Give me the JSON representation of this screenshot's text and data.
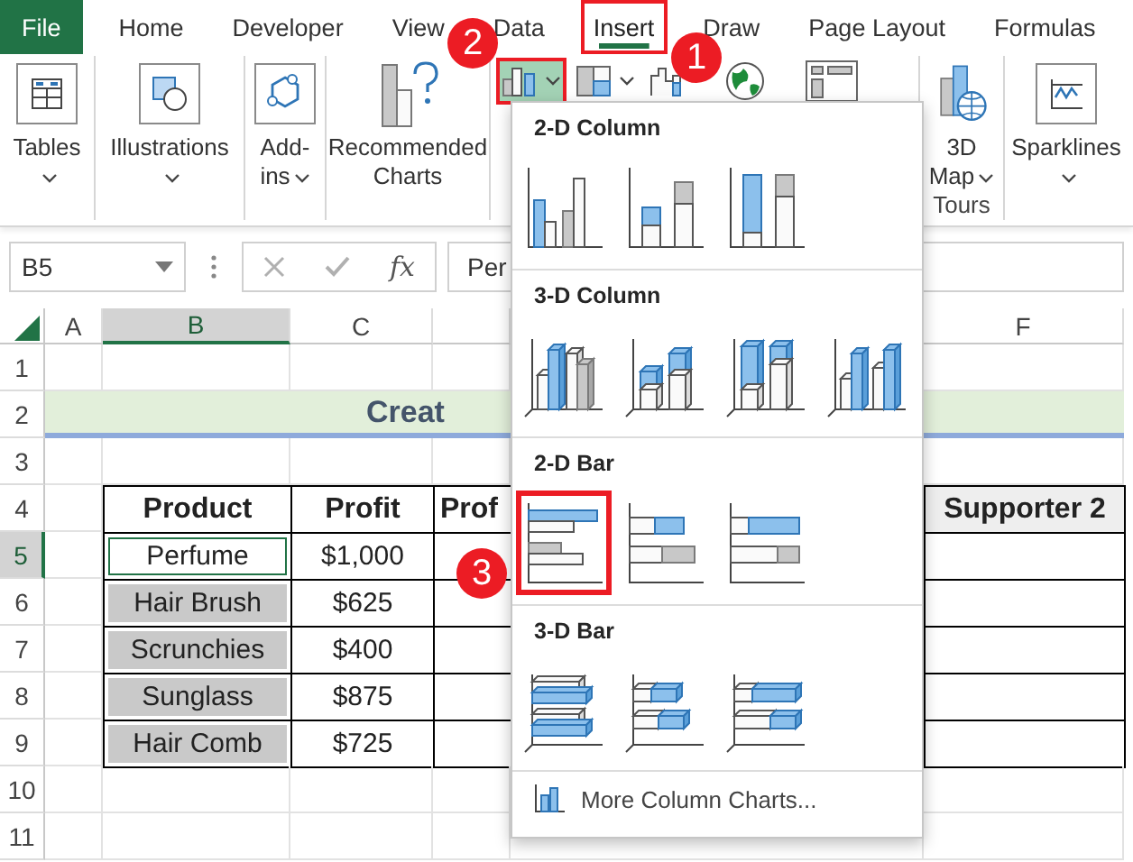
{
  "tabs": [
    {
      "label": "File",
      "kind": "file",
      "selected": false
    },
    {
      "label": "Home",
      "kind": "tab",
      "selected": false
    },
    {
      "label": "Developer",
      "kind": "tab",
      "selected": false
    },
    {
      "label": "View",
      "kind": "tab",
      "selected": false
    },
    {
      "label": "Data",
      "kind": "tab",
      "selected": false
    },
    {
      "label": "Insert",
      "kind": "tab",
      "selected": true,
      "callout": "1"
    },
    {
      "label": "Draw",
      "kind": "tab",
      "selected": false
    },
    {
      "label": "Page Layout",
      "kind": "tab",
      "selected": false
    },
    {
      "label": "Formulas",
      "kind": "tab",
      "selected": false
    }
  ],
  "ribbon_left": [
    {
      "label": "Tables",
      "dropdown": true
    },
    {
      "label": "Illustrations",
      "dropdown": true
    },
    {
      "label": "Add-ins",
      "dropdown": true
    },
    {
      "label": "Recommended Charts",
      "dropdown": false
    }
  ],
  "chart_buttons": [
    {
      "dropdown": true,
      "pressed": true,
      "callout": "2"
    },
    {
      "dropdown": true,
      "pressed": false
    },
    {
      "dropdown": false,
      "pressed": false
    },
    {
      "dropdown": false,
      "pressed": false
    },
    {
      "dropdown": false,
      "pressed": false
    }
  ],
  "ribbon_right": [
    {
      "label": "3D Map",
      "dropdown": true,
      "group_label": "Tours"
    },
    {
      "label": "Sparklines",
      "dropdown": true
    }
  ],
  "formula_bar": {
    "name_box": "B5",
    "function_label": "fx",
    "formula": "Per"
  },
  "sheet": {
    "columns": [
      {
        "label": "A",
        "selected": false
      },
      {
        "label": "B",
        "selected": true
      },
      {
        "label": "C",
        "selected": false
      },
      {
        "selected": false
      },
      {
        "label": "F",
        "selected": false
      }
    ],
    "rows": [
      {
        "number": "1",
        "selected": false
      },
      {
        "number": "2",
        "selected": false
      },
      {
        "number": "3",
        "selected": false
      },
      {
        "number": "4",
        "selected": false
      },
      {
        "number": "5",
        "selected": true
      },
      {
        "number": "6",
        "selected": false
      },
      {
        "number": "7",
        "selected": false
      },
      {
        "number": "8",
        "selected": false
      },
      {
        "number": "9",
        "selected": false
      },
      {
        "number": "10",
        "selected": false
      },
      {
        "number": "11",
        "selected": false
      }
    ],
    "title": "Creat",
    "table": {
      "header": [
        "Product",
        "Profit",
        "Prof",
        "Supporter 2"
      ],
      "rows": [
        {
          "product": "Perfume",
          "profit": "$1,000",
          "selected": true
        },
        {
          "product": "Hair Brush",
          "profit": "$625",
          "selected": false
        },
        {
          "product": "Scrunchies",
          "profit": "$400",
          "selected": false
        },
        {
          "product": "Sunglass",
          "profit": "$875",
          "selected": false
        },
        {
          "product": "Hair Comb",
          "profit": "$725",
          "selected": false
        }
      ]
    }
  },
  "chart_menu": {
    "sections": [
      {
        "title": "2-D Column",
        "kind": "column",
        "items": [
          {
            "kind": "clustered"
          },
          {
            "kind": "stacked"
          },
          {
            "kind": "percent"
          }
        ]
      },
      {
        "title": "3-D Column",
        "kind": "column3d",
        "items": [
          {
            "kind": "clustered"
          },
          {
            "kind": "stacked"
          },
          {
            "kind": "percent"
          },
          {
            "kind": "deep"
          }
        ]
      },
      {
        "title": "2-D Bar",
        "kind": "bar",
        "items": [
          {
            "kind": "clustered",
            "callout": "3"
          },
          {
            "kind": "stacked"
          },
          {
            "kind": "percent"
          }
        ]
      },
      {
        "title": "3-D Bar",
        "kind": "bar3d",
        "items": [
          {
            "kind": "clustered"
          },
          {
            "kind": "stacked"
          },
          {
            "kind": "percent"
          }
        ]
      }
    ],
    "footer": "More Column Charts..."
  }
}
